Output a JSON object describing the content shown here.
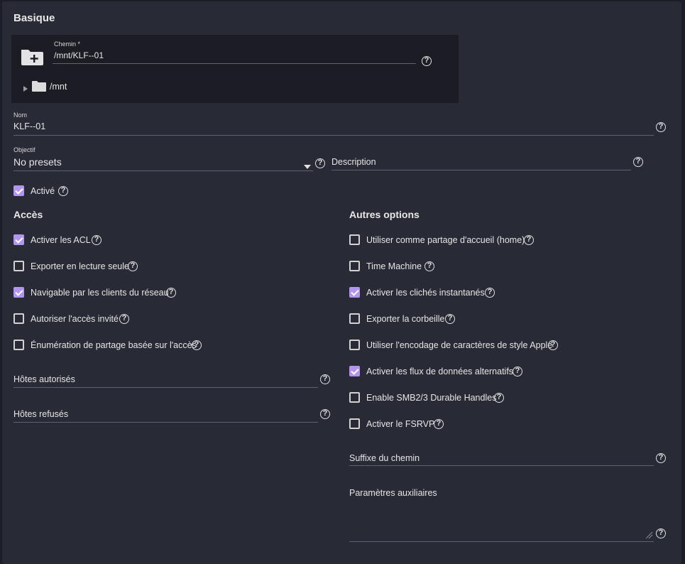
{
  "basic": {
    "title": "Basique",
    "path_label": "Chemin *",
    "path_value": "/mnt/KLF--01",
    "tree_root": "/mnt",
    "name_label": "Nom",
    "name_value": "KLF--01",
    "purpose_label": "Objectif",
    "purpose_value": "No presets",
    "description_placeholder": "Description",
    "enabled_label": "Activé",
    "enabled_checked": true
  },
  "access": {
    "title": "Accès",
    "options": [
      {
        "label": "Activer les ACL",
        "checked": true
      },
      {
        "label": "Exporter en lecture seule",
        "checked": false
      },
      {
        "label": "Navigable par les clients du réseau",
        "checked": true
      },
      {
        "label": "Autoriser l'accès invité",
        "checked": false
      },
      {
        "label": "Énumération de partage basée sur l'accès",
        "checked": false
      }
    ],
    "allowed_hosts_placeholder": "Hôtes autorisés",
    "denied_hosts_placeholder": "Hôtes refusés"
  },
  "other": {
    "title": "Autres options",
    "options": [
      {
        "label": "Utiliser comme partage d'accueil (home)",
        "checked": false
      },
      {
        "label": "Time Machine",
        "checked": false
      },
      {
        "label": "Activer les clichés instantanés",
        "checked": true
      },
      {
        "label": "Exporter la corbeille",
        "checked": false
      },
      {
        "label": "Utiliser l'encodage de caractères de style Apple",
        "checked": false
      },
      {
        "label": "Activer les flux de données alternatifs",
        "checked": true
      },
      {
        "label": "Enable SMB2/3 Durable Handles",
        "checked": false
      },
      {
        "label": "Activer le FSRVP",
        "checked": false
      }
    ],
    "path_suffix_placeholder": "Suffixe du chemin",
    "aux_params_placeholder": "Paramètres auxiliaires"
  },
  "icons": {
    "help": "?",
    "folder_add": "folder-plus-icon",
    "folder": "folder-icon",
    "expand": "caret-right-icon",
    "dropdown": "caret-down-icon"
  },
  "colors": {
    "background": "#282a35",
    "checkbox_accent": "#b395ee",
    "explorer_bg": "#1b1c24"
  }
}
